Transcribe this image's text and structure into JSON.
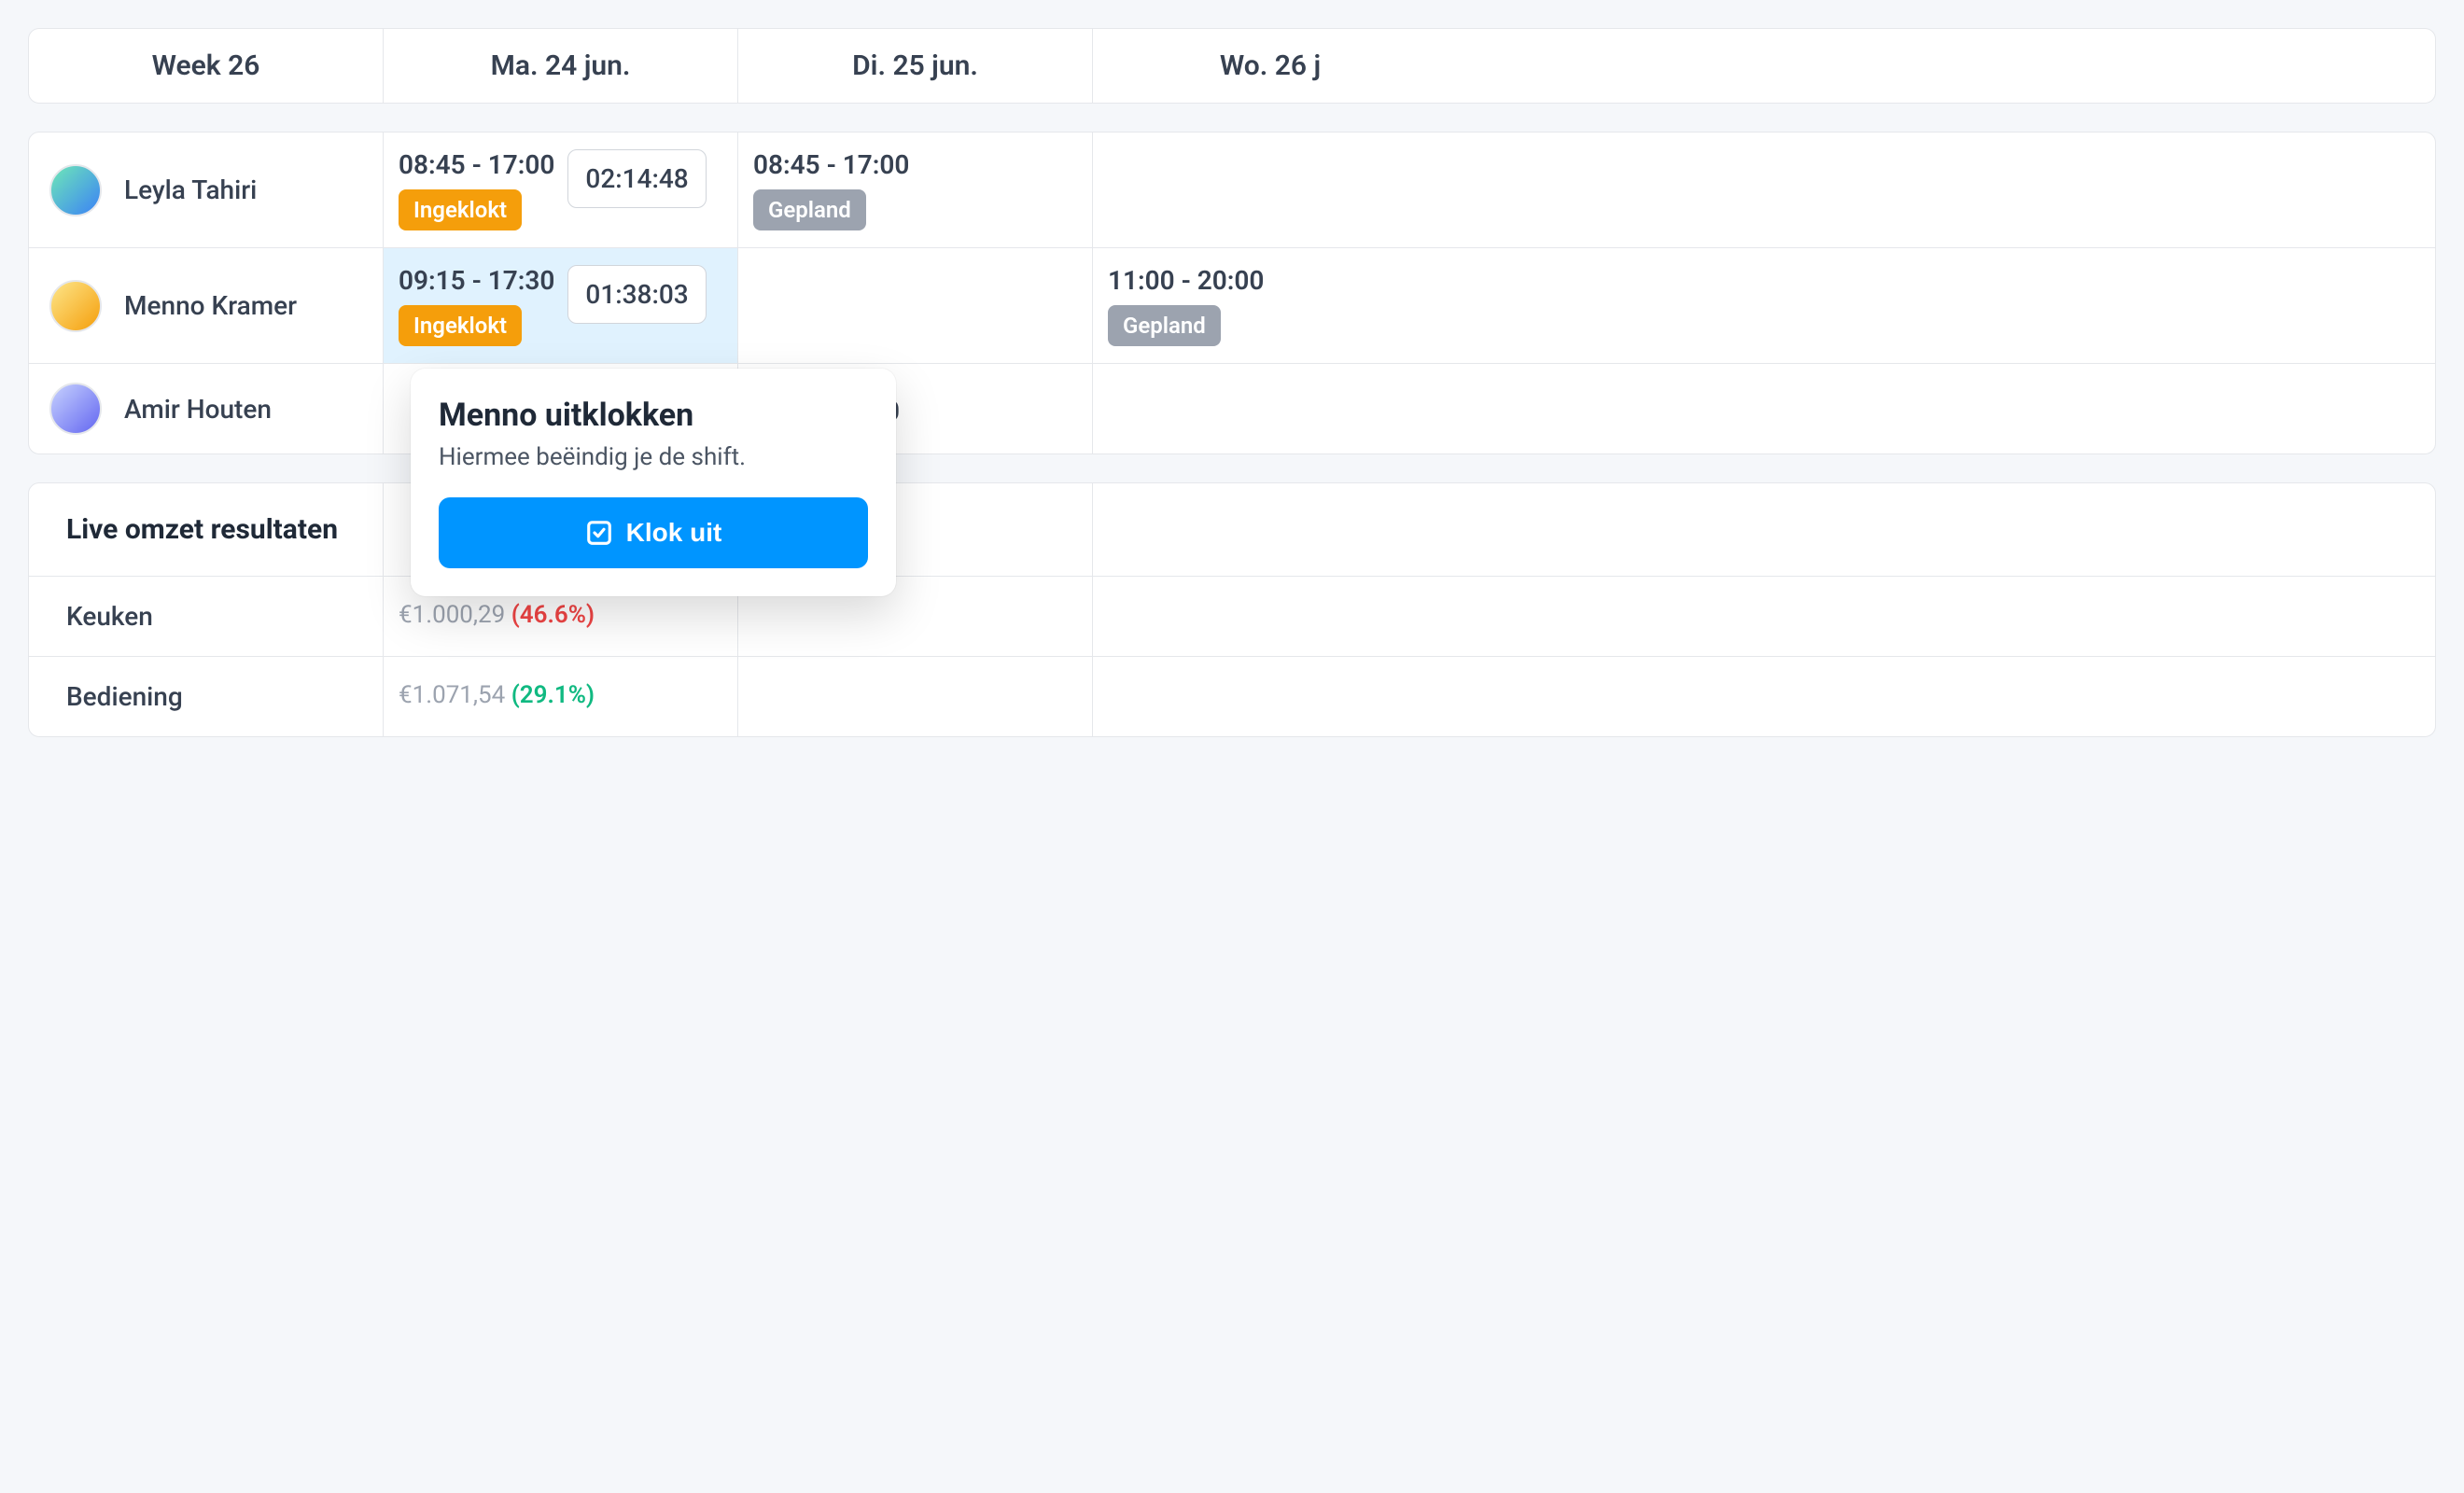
{
  "header": {
    "week": "Week 26",
    "days": [
      "Ma. 24 jun.",
      "Di. 25 jun.",
      "Wo. 26 j"
    ]
  },
  "employees": [
    {
      "name": "Leyla Tahiri",
      "shifts": [
        {
          "time": "08:45 - 17:00",
          "status": "Ingeklokt",
          "statusType": "orange",
          "timer": "02:14:48"
        },
        {
          "time": "08:45 - 17:00",
          "status": "Gepland",
          "statusType": "gray"
        },
        null
      ]
    },
    {
      "name": "Menno Kramer",
      "shifts": [
        {
          "time": "09:15 - 17:30",
          "status": "Ingeklokt",
          "statusType": "orange",
          "timer": "01:38:03",
          "highlighted": true
        },
        null,
        {
          "time": "11:00 - 20:00",
          "status": "Gepland",
          "statusType": "gray"
        }
      ]
    },
    {
      "name": "Amir Houten",
      "shifts": [
        null,
        null,
        null
      ]
    }
  ],
  "partialTime": "0",
  "revenue": {
    "title": "Live omzet resultaten",
    "rows": [
      {
        "label": "Keuken",
        "amount": "€1.000,29",
        "pct": "(46.6%)",
        "pctType": "red"
      },
      {
        "label": "Bediening",
        "amount": "€1.071,54",
        "pct": "(29.1%)",
        "pctType": "green"
      }
    ]
  },
  "popover": {
    "title": "Menno uitklokken",
    "subtitle": "Hiermee beëindig je de shift.",
    "button": "Klok uit"
  }
}
